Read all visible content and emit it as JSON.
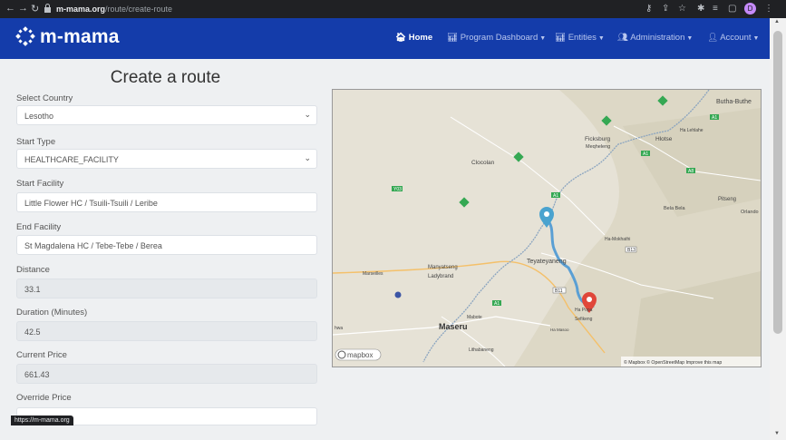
{
  "browser": {
    "url_host": "m-mama.org",
    "url_path": "/route/create-route",
    "status_url": "https://m-mama.org"
  },
  "navbar": {
    "brand": "m-mama",
    "items": [
      {
        "label": "Home"
      },
      {
        "label": "Program Dashboard"
      },
      {
        "label": "Entities"
      },
      {
        "label": "Administration"
      },
      {
        "label": "Account"
      }
    ]
  },
  "form": {
    "title": "Create a route",
    "country": {
      "label": "Select Country",
      "value": "Lesotho"
    },
    "start_type": {
      "label": "Start Type",
      "value": "HEALTHCARE_FACILITY"
    },
    "start_facility": {
      "label": "Start Facility",
      "value": "Little Flower HC / Tsuili-Tsuili / Leribe"
    },
    "end_facility": {
      "label": "End Facility",
      "value": "St Magdalena HC / Tebe-Tebe / Berea"
    },
    "distance": {
      "label": "Distance",
      "value": "33.1"
    },
    "duration": {
      "label": "Duration (Minutes)",
      "value": "42.5"
    },
    "current_price": {
      "label": "Current Price",
      "value": "661.43"
    },
    "override_price": {
      "label": "Override Price"
    }
  },
  "map": {
    "places": [
      {
        "name": "Butha-Buthe"
      },
      {
        "name": "Ha Lehlahe"
      },
      {
        "name": "Ficksburg"
      },
      {
        "name": "Hlotse"
      },
      {
        "name": "Meqheleng"
      },
      {
        "name": "Clocolan"
      },
      {
        "name": "Pitseng"
      },
      {
        "name": "Bela Bela"
      },
      {
        "name": "Orlando"
      },
      {
        "name": "Ha-Mokhathi"
      },
      {
        "name": "Teyateyaneng"
      },
      {
        "name": "Marseilles"
      },
      {
        "name": "Manyatseng"
      },
      {
        "name": "Ladybrand"
      },
      {
        "name": "Ha Popa"
      },
      {
        "name": "Sefikeng"
      },
      {
        "name": "Mabote"
      },
      {
        "name": "Maseru"
      },
      {
        "name": "Ha Masoo"
      },
      {
        "name": "hwa"
      },
      {
        "name": "Lithabaneng"
      }
    ],
    "road_shields": [
      "B13",
      "B11",
      "A1"
    ],
    "logo": "mapbox",
    "attribution": "© Mapbox © OpenStreetMap Improve this map",
    "route_color": "#5a9fd4",
    "start_marker_color": "#4aa3cf",
    "end_marker_color": "#e0473a"
  }
}
